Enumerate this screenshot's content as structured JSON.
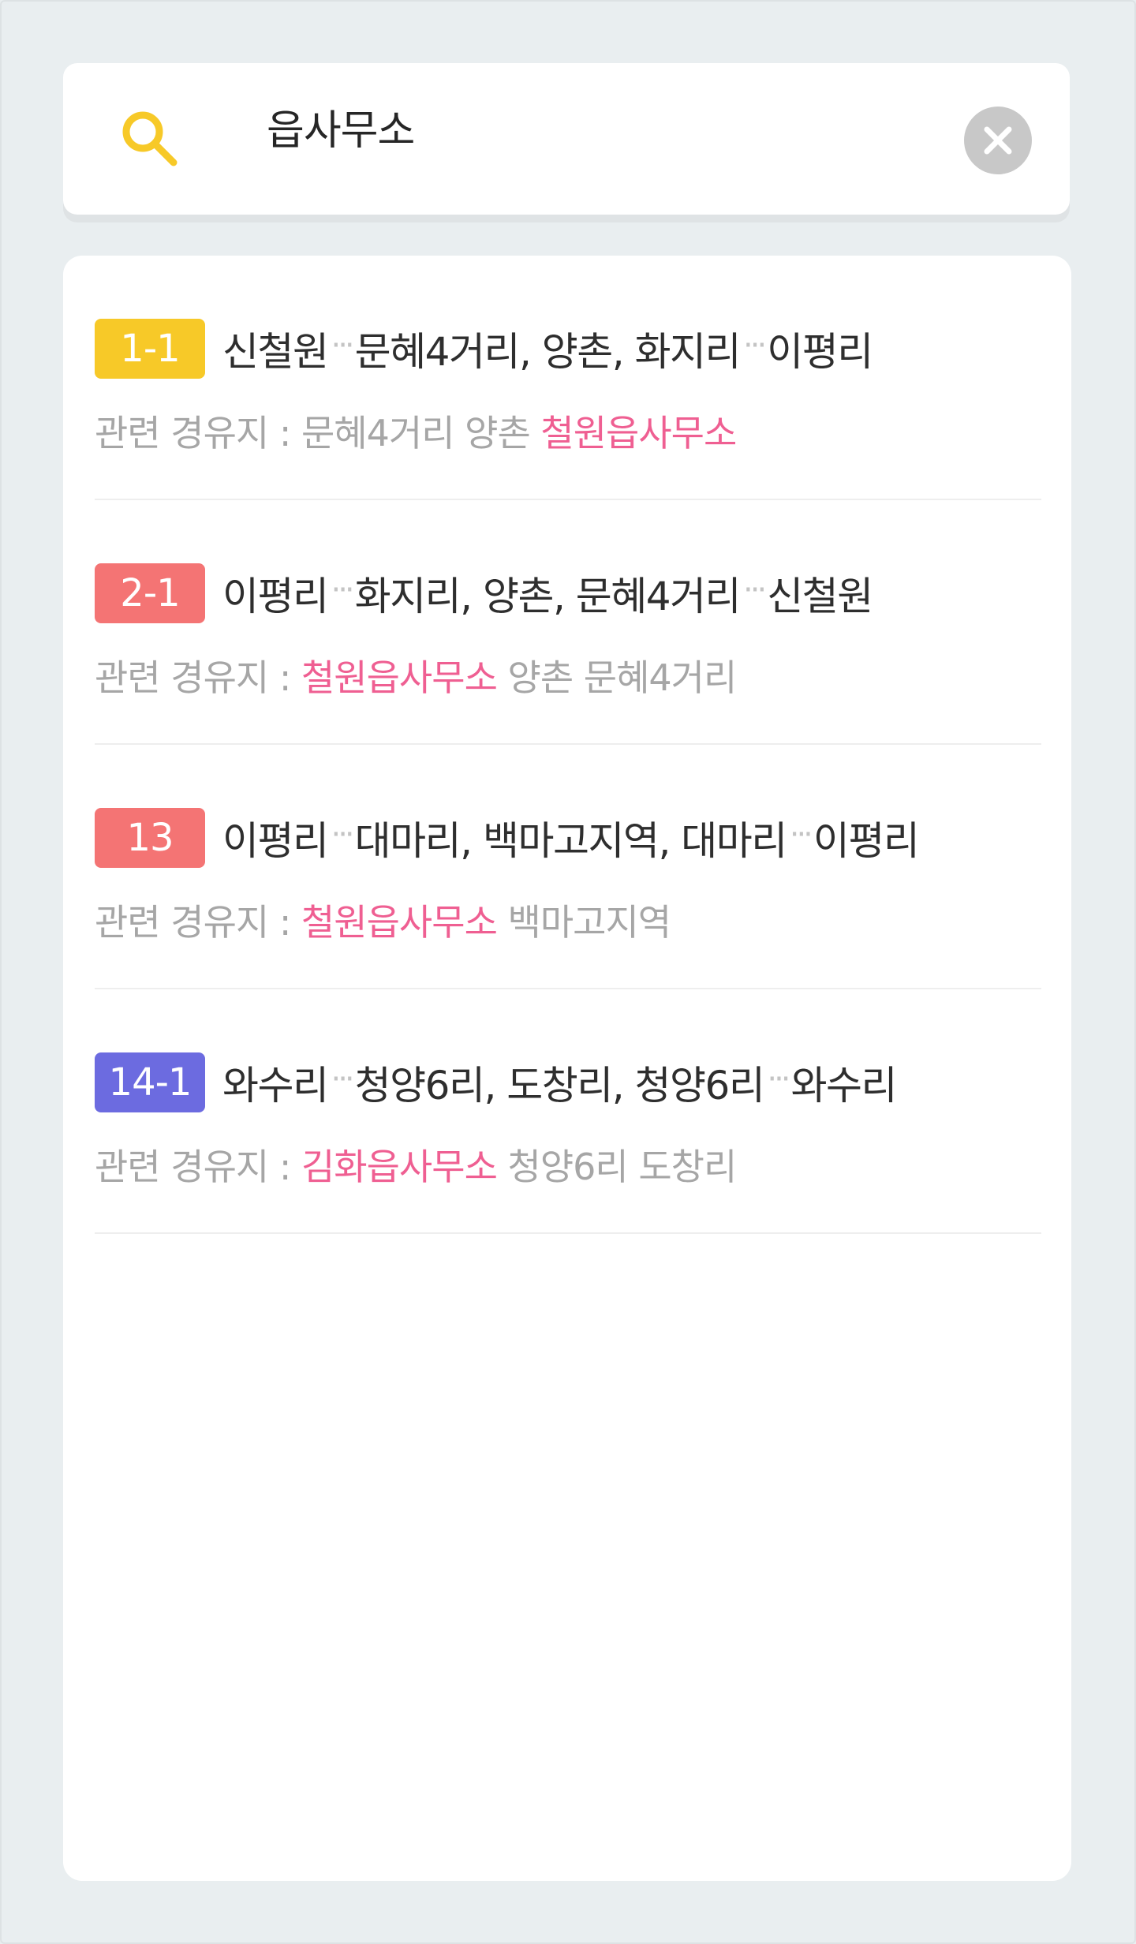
{
  "search": {
    "query": "읍사무소"
  },
  "colors": {
    "accent_yellow": "#f7c928",
    "highlight_pink": "#ef5f92",
    "badge_yellow": "#f7c928",
    "badge_red": "#f47474",
    "badge_purple": "#6c6be0"
  },
  "results": [
    {
      "number": "1-1",
      "badge_color": "#f7c928",
      "origin": "신철원",
      "via": "문혜4거리, 양촌, 화지리",
      "dest": "이평리",
      "via_label": "관련 경유지 :",
      "via_before": "문혜4거리 양촌",
      "via_match": "철원읍사무소",
      "via_after": ""
    },
    {
      "number": "2-1",
      "badge_color": "#f47474",
      "origin": "이평리",
      "via": "화지리, 양촌, 문혜4거리",
      "dest": "신철원",
      "via_label": "관련 경유지 :",
      "via_before": "",
      "via_match": "철원읍사무소",
      "via_after": "양촌 문혜4거리"
    },
    {
      "number": "13",
      "badge_color": "#f47474",
      "origin": "이평리",
      "via": "대마리, 백마고지역, 대마리",
      "dest": "이평리",
      "via_label": "관련 경유지 :",
      "via_before": "",
      "via_match": "철원읍사무소",
      "via_after": "백마고지역"
    },
    {
      "number": "14-1",
      "badge_color": "#6c6be0",
      "origin": "와수리",
      "via": "청양6리, 도창리, 청양6리",
      "dest": "와수리",
      "via_label": "관련 경유지 :",
      "via_before": "",
      "via_match": "김화읍사무소",
      "via_after": "청양6리 도창리"
    }
  ],
  "separator": "···"
}
